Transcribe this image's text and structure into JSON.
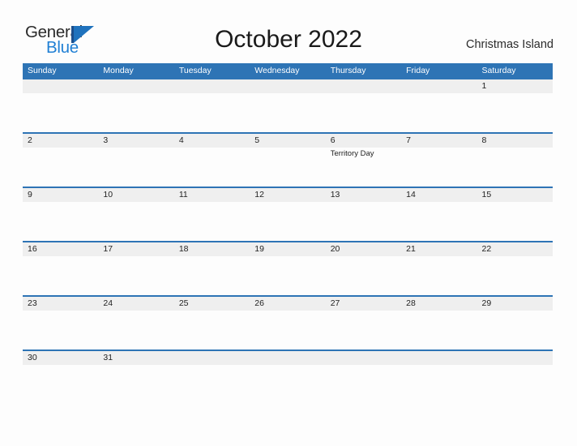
{
  "logo": {
    "text_primary": "General",
    "text_secondary": "Blue",
    "flag_icon": "flag-triangle-icon",
    "primary_color": "#2b2b2b",
    "secondary_color": "#1f7fd4",
    "flag_color": "#1f72bd"
  },
  "header": {
    "title": "October 2022",
    "location": "Christmas Island"
  },
  "theme": {
    "header_blue": "#2e74b5",
    "band_gray": "#efefef",
    "rule_blue": "#2e74b5",
    "page_background": "#fdfdfd",
    "text_color": "#222222"
  },
  "calendar": {
    "month": "October",
    "year": "2022",
    "weekdays": [
      "Sunday",
      "Monday",
      "Tuesday",
      "Wednesday",
      "Thursday",
      "Friday",
      "Saturday"
    ],
    "weeks": [
      {
        "days": [
          {
            "num": "",
            "event": ""
          },
          {
            "num": "",
            "event": ""
          },
          {
            "num": "",
            "event": ""
          },
          {
            "num": "",
            "event": ""
          },
          {
            "num": "",
            "event": ""
          },
          {
            "num": "",
            "event": ""
          },
          {
            "num": "1",
            "event": ""
          }
        ]
      },
      {
        "days": [
          {
            "num": "2",
            "event": ""
          },
          {
            "num": "3",
            "event": ""
          },
          {
            "num": "4",
            "event": ""
          },
          {
            "num": "5",
            "event": ""
          },
          {
            "num": "6",
            "event": "Territory Day"
          },
          {
            "num": "7",
            "event": ""
          },
          {
            "num": "8",
            "event": ""
          }
        ]
      },
      {
        "days": [
          {
            "num": "9",
            "event": ""
          },
          {
            "num": "10",
            "event": ""
          },
          {
            "num": "11",
            "event": ""
          },
          {
            "num": "12",
            "event": ""
          },
          {
            "num": "13",
            "event": ""
          },
          {
            "num": "14",
            "event": ""
          },
          {
            "num": "15",
            "event": ""
          }
        ]
      },
      {
        "days": [
          {
            "num": "16",
            "event": ""
          },
          {
            "num": "17",
            "event": ""
          },
          {
            "num": "18",
            "event": ""
          },
          {
            "num": "19",
            "event": ""
          },
          {
            "num": "20",
            "event": ""
          },
          {
            "num": "21",
            "event": ""
          },
          {
            "num": "22",
            "event": ""
          }
        ]
      },
      {
        "days": [
          {
            "num": "23",
            "event": ""
          },
          {
            "num": "24",
            "event": ""
          },
          {
            "num": "25",
            "event": ""
          },
          {
            "num": "26",
            "event": ""
          },
          {
            "num": "27",
            "event": ""
          },
          {
            "num": "28",
            "event": ""
          },
          {
            "num": "29",
            "event": ""
          }
        ]
      },
      {
        "days": [
          {
            "num": "30",
            "event": ""
          },
          {
            "num": "31",
            "event": ""
          },
          {
            "num": "",
            "event": ""
          },
          {
            "num": "",
            "event": ""
          },
          {
            "num": "",
            "event": ""
          },
          {
            "num": "",
            "event": ""
          },
          {
            "num": "",
            "event": ""
          }
        ]
      }
    ]
  }
}
